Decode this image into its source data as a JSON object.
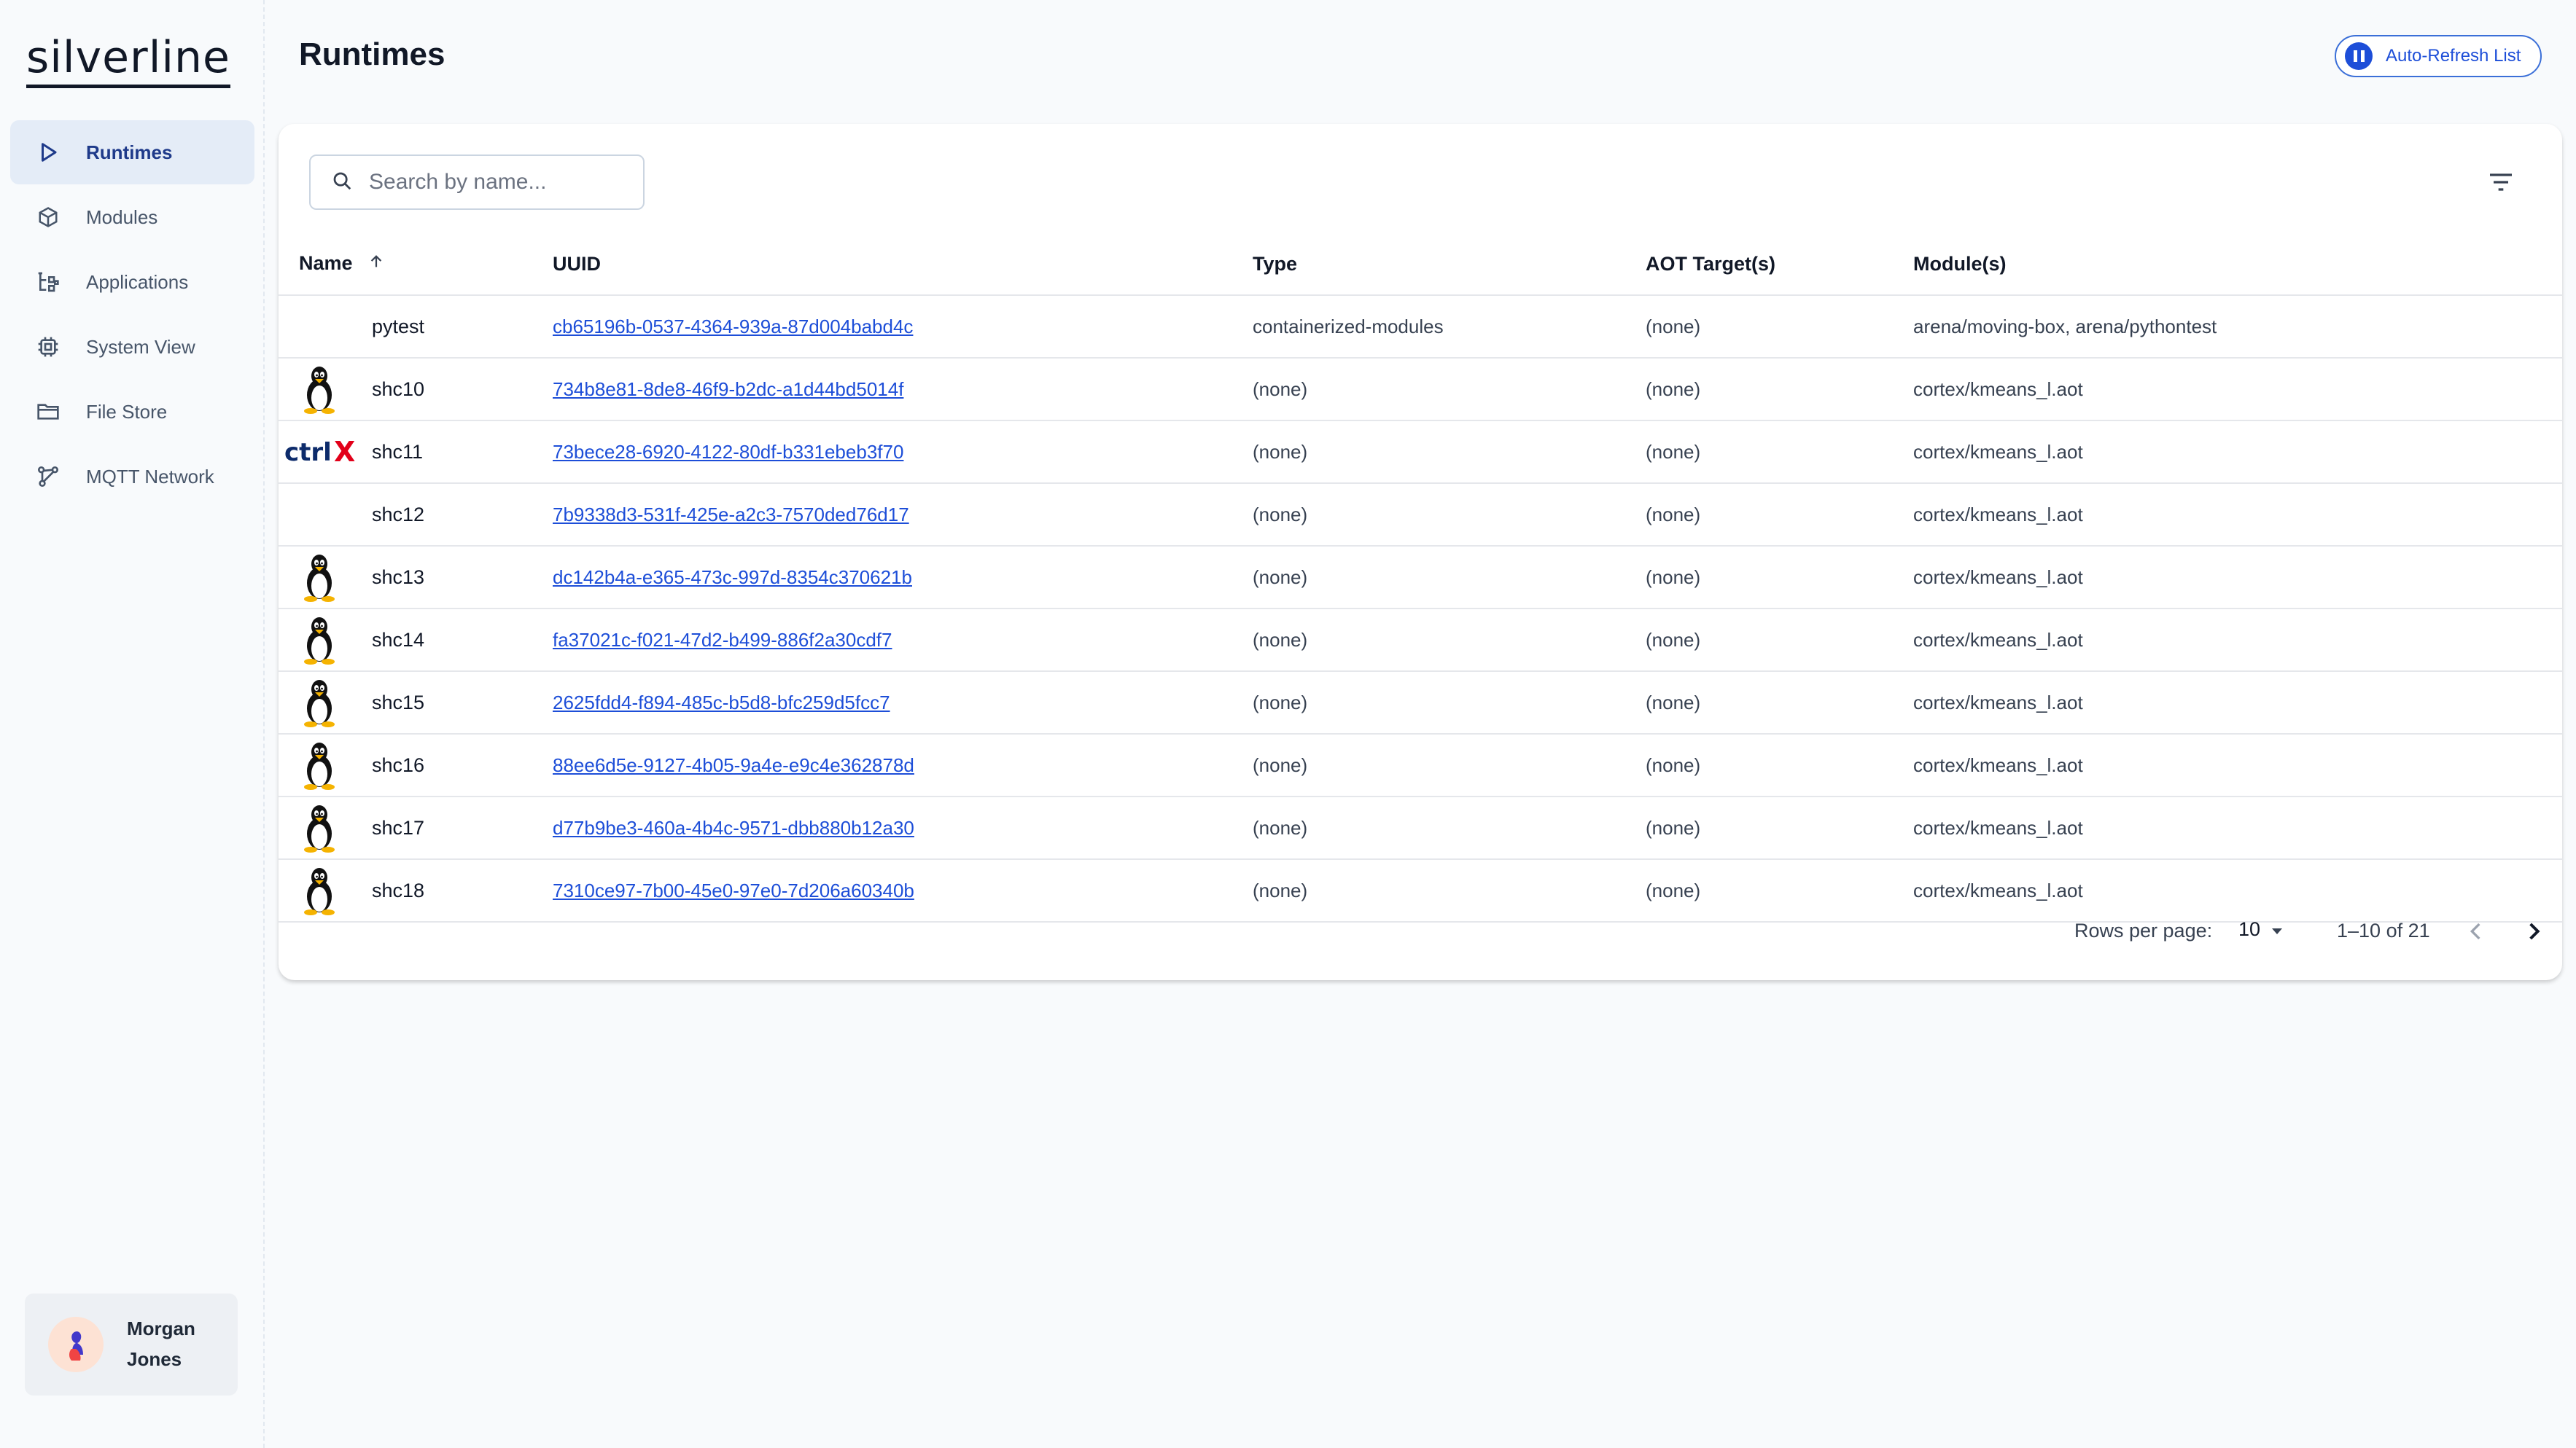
{
  "app": {
    "logo_text": "silverline"
  },
  "sidebar": {
    "items": [
      {
        "label": "Runtimes",
        "icon": "play-icon",
        "active": true
      },
      {
        "label": "Modules",
        "icon": "cube-icon",
        "active": false
      },
      {
        "label": "Applications",
        "icon": "flow-icon",
        "active": false
      },
      {
        "label": "System View",
        "icon": "chip-icon",
        "active": false
      },
      {
        "label": "File Store",
        "icon": "folder-icon",
        "active": false
      },
      {
        "label": "MQTT Network",
        "icon": "network-icon",
        "active": false
      }
    ],
    "user": {
      "name": "Morgan Jones"
    }
  },
  "header": {
    "title": "Runtimes",
    "refresh_button": "Auto-Refresh List"
  },
  "search": {
    "placeholder": "Search by name..."
  },
  "table": {
    "columns": [
      "Name",
      "UUID",
      "Type",
      "AOT Target(s)",
      "Module(s)"
    ],
    "sort": {
      "column": "Name",
      "direction": "ascending"
    },
    "rows": [
      {
        "icon": "none",
        "name": "pytest",
        "uuid": "cb65196b-0537-4364-939a-87d004babd4c",
        "type": "containerized-modules",
        "aot": "(none)",
        "modules": "arena/moving-box, arena/pythontest"
      },
      {
        "icon": "linux",
        "name": "shc10",
        "uuid": "734b8e81-8de8-46f9-b2dc-a1d44bd5014f",
        "type": "(none)",
        "aot": "(none)",
        "modules": "cortex/kmeans_l.aot"
      },
      {
        "icon": "ctrlx",
        "name": "shc11",
        "uuid": "73bece28-6920-4122-80df-b331ebeb3f70",
        "type": "(none)",
        "aot": "(none)",
        "modules": "cortex/kmeans_l.aot"
      },
      {
        "icon": "none",
        "name": "shc12",
        "uuid": "7b9338d3-531f-425e-a2c3-7570ded76d17",
        "type": "(none)",
        "aot": "(none)",
        "modules": "cortex/kmeans_l.aot"
      },
      {
        "icon": "linux",
        "name": "shc13",
        "uuid": "dc142b4a-e365-473c-997d-8354c370621b",
        "type": "(none)",
        "aot": "(none)",
        "modules": "cortex/kmeans_l.aot"
      },
      {
        "icon": "linux",
        "name": "shc14",
        "uuid": "fa37021c-f021-47d2-b499-886f2a30cdf7",
        "type": "(none)",
        "aot": "(none)",
        "modules": "cortex/kmeans_l.aot"
      },
      {
        "icon": "linux",
        "name": "shc15",
        "uuid": "2625fdd4-f894-485c-b5d8-bfc259d5fcc7",
        "type": "(none)",
        "aot": "(none)",
        "modules": "cortex/kmeans_l.aot"
      },
      {
        "icon": "linux",
        "name": "shc16",
        "uuid": "88ee6d5e-9127-4b05-9a4e-e9c4e362878d",
        "type": "(none)",
        "aot": "(none)",
        "modules": "cortex/kmeans_l.aot"
      },
      {
        "icon": "linux",
        "name": "shc17",
        "uuid": "d77b9be3-460a-4b4c-9571-dbb880b12a30",
        "type": "(none)",
        "aot": "(none)",
        "modules": "cortex/kmeans_l.aot"
      },
      {
        "icon": "linux",
        "name": "shc18",
        "uuid": "7310ce97-7b00-45e0-97e0-7d206a60340b",
        "type": "(none)",
        "aot": "(none)",
        "modules": "cortex/kmeans_l.aot"
      }
    ]
  },
  "pagination": {
    "rows_per_page_label": "Rows per page:",
    "rows_per_page": "10",
    "range": "1–10 of 21"
  },
  "colors": {
    "accent": "#1d4ed8",
    "active_nav_bg": "#e4ecf7",
    "ctrlx_blue": "#0d2b6b",
    "ctrlx_red": "#e2001a"
  }
}
